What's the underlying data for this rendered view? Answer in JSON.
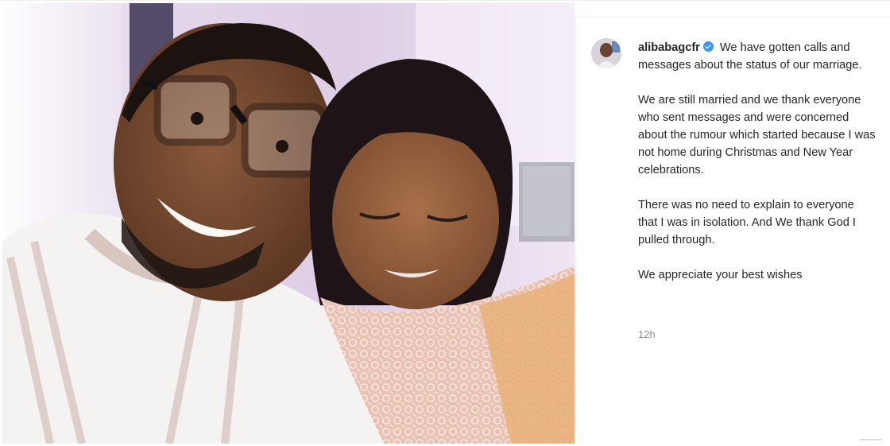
{
  "post": {
    "username": "alibabagcfr",
    "verified": true,
    "caption_first_line": "We have gotten calls and messages about the status of our marriage.",
    "caption_paragraphs": [
      "We are still married and we thank everyone who sent messages and were concerned about the rumour which started because I was not home during Christmas and New Year celebrations.",
      "There was no need to explain to everyone that I was in isolation. And We thank God I pulled through.",
      "We appreciate your best wishes"
    ],
    "timestamp": "12h"
  },
  "colors": {
    "text": "#262626",
    "muted": "#8e8e8e",
    "verified_badge": "#3897f0",
    "border": "#efefef"
  },
  "icons": {
    "verified": "verified-badge-icon"
  }
}
